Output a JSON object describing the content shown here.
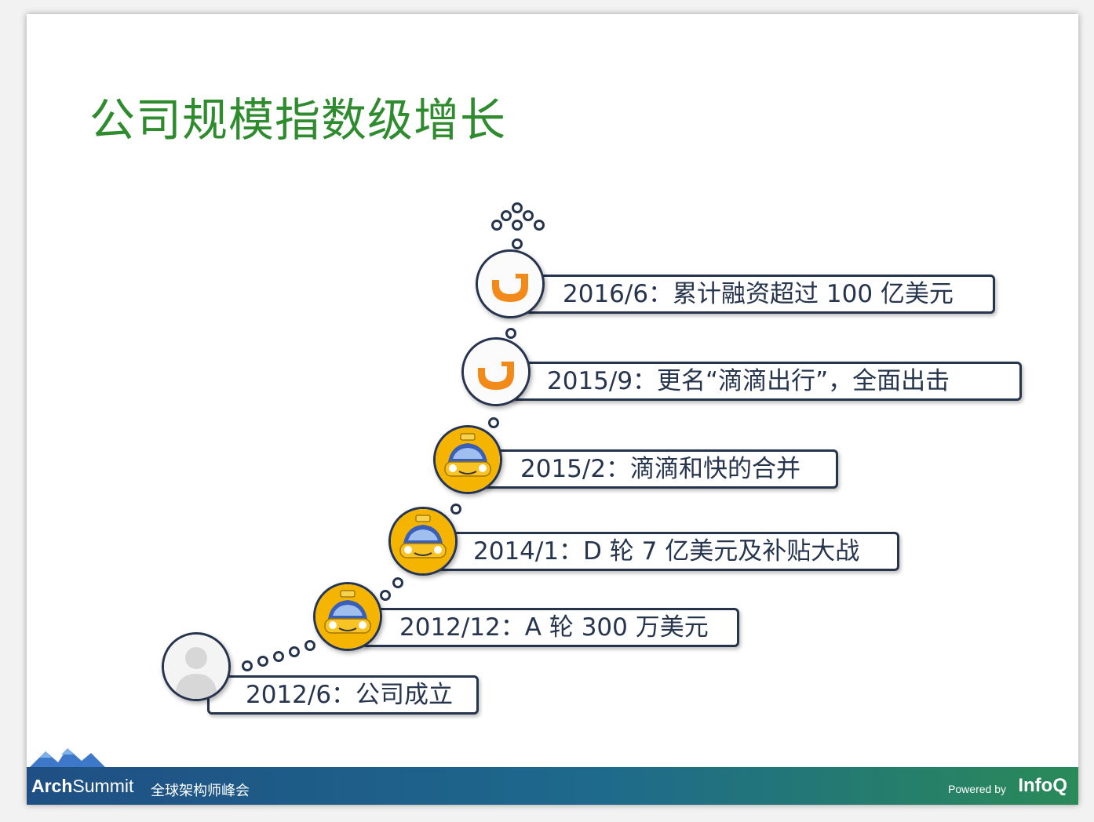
{
  "title": "公司规模指数级增长",
  "events": [
    {
      "label": "2012/6：公司成立",
      "icon": "person-avatar-icon"
    },
    {
      "label": "2012/12：A 轮 300 万美元",
      "icon": "taxi-icon"
    },
    {
      "label": "2014/1：D 轮 7 亿美元及补贴大战",
      "icon": "taxi-icon"
    },
    {
      "label": "2015/2：滴滴和快的合并",
      "icon": "taxi-icon"
    },
    {
      "label": "2015/9：更名“滴滴出行”，全面出击",
      "icon": "didi-logo-icon"
    },
    {
      "label": "2016/6：累计融资超过 100 亿美元",
      "icon": "didi-logo-icon"
    }
  ],
  "footer": {
    "brand_bold": "Arch",
    "brand_light": "Summit",
    "tagline": "全球架构师峰会",
    "powered_by": "Powered by",
    "infoq": "InfoQ"
  },
  "colors": {
    "title": "#2e8b2e",
    "outline": "#26344d",
    "taxi_yellow": "#f4b400",
    "didi_orange": "#f28a1a"
  }
}
